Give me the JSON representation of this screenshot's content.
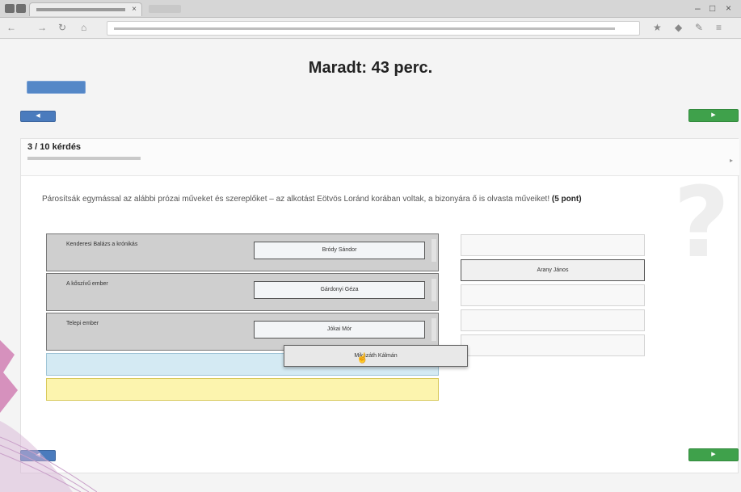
{
  "timer": "Maradt: 43 perc.",
  "question": {
    "counter": "3 / 10 kérdés",
    "prompt": "Párosítsák egymással az alábbi prózai műveket és szereplőket – az alkotást Eötvös Loránd korában voltak, a bizonyára ő is olvasta műveiket!",
    "points": "(5 pont)"
  },
  "rows": [
    {
      "label": "Kenderesi Balázs a krónikás",
      "answer": "Bródy Sándor"
    },
    {
      "label": "A kőszívű ember",
      "answer": "Gárdonyi Géza"
    },
    {
      "label": "Telepi ember",
      "answer": "Jókai Mór"
    }
  ],
  "drag_item": "Mikszáth Kálmán",
  "options": [
    "",
    "Arany János",
    "",
    "",
    ""
  ],
  "colors": {
    "blue_button": "#4a7bbd",
    "green_button": "#3fa14b",
    "drop_row": "#cfcfcf",
    "highlight_blue": "#d4eaf3",
    "highlight_yellow": "#fcf4ae"
  }
}
